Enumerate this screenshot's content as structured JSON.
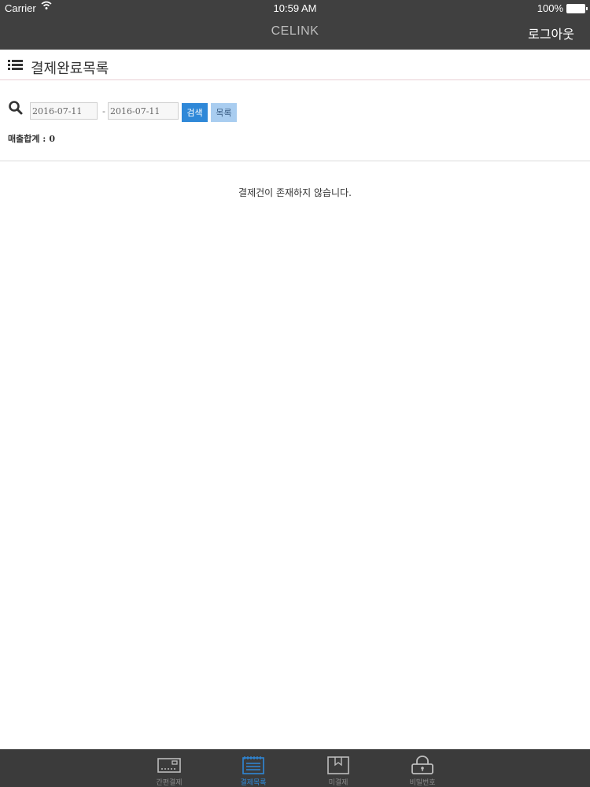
{
  "status_bar": {
    "carrier": "Carrier",
    "time": "10:59 AM",
    "battery": "100%"
  },
  "navbar": {
    "title": "CELINK",
    "logout_label": "로그아웃"
  },
  "page": {
    "title": "결제완료목록"
  },
  "search": {
    "start_date": "2016-07-11",
    "separator": "-",
    "end_date": "2016-07-11",
    "search_label": "검색",
    "list_label": "목록"
  },
  "sales": {
    "label": "매출합계 :",
    "amount": "0"
  },
  "empty_message": "결제건이 존재하지 않습니다.",
  "tabs": [
    {
      "label": "간편결제",
      "icon": "card-reader-icon",
      "active": false
    },
    {
      "label": "결제목록",
      "icon": "notebook-list-icon",
      "active": true
    },
    {
      "label": "미결제",
      "icon": "pending-doc-icon",
      "active": false
    },
    {
      "label": "비밀번호",
      "icon": "lock-icon",
      "active": false
    }
  ],
  "colors": {
    "bar": "#404040",
    "accent": "#2f88d8",
    "accent_light": "#a9cdf0"
  }
}
